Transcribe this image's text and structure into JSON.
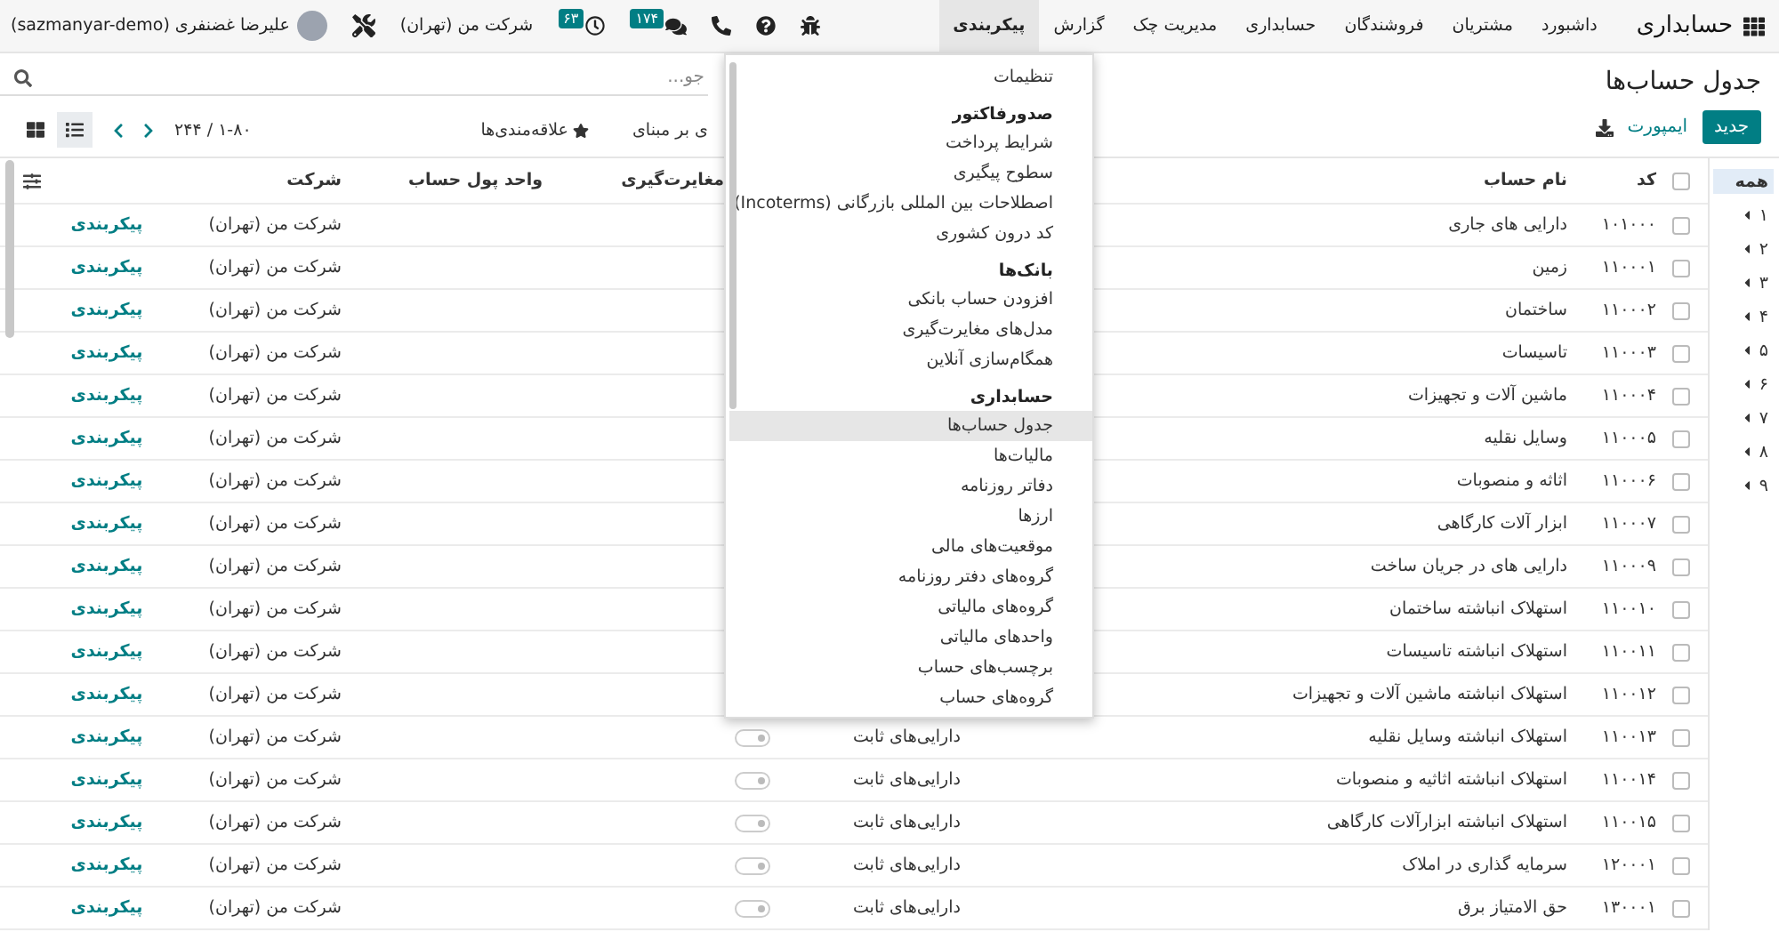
{
  "navbar": {
    "app_name": "حسابداری",
    "menu": [
      {
        "label": "داشبورد",
        "selected": false
      },
      {
        "label": "مشتریان",
        "selected": false
      },
      {
        "label": "فروشندگان",
        "selected": false
      },
      {
        "label": "حسابداری",
        "selected": false
      },
      {
        "label": "مدیریت چک",
        "selected": false
      },
      {
        "label": "گزارش",
        "selected": false
      },
      {
        "label": "پیکربندی",
        "selected": true
      }
    ],
    "systray": {
      "chat_badge": "۱۷۴",
      "activity_badge": "۶۳",
      "company": "شرکت من (تهران)",
      "user": "علیرضا غضنفری (sazmanyar-demo)"
    }
  },
  "control_panel": {
    "title": "جدول حساب‌ها",
    "new_button": "جدید",
    "import_button": "ایمپورت",
    "search": {
      "placeholder": "جو..."
    },
    "group_by": "ی بر مبنای",
    "favorites": "علاقه‌مندی‌ها",
    "pager": "۱-۸۰ / ۲۴۴",
    "views": [
      {
        "kind": "list",
        "selected": true
      },
      {
        "kind": "kanban",
        "selected": false
      }
    ]
  },
  "sidebar": {
    "items": [
      {
        "label": "همه",
        "selected": true
      },
      {
        "label": "۱",
        "selected": false
      },
      {
        "label": "۲",
        "selected": false
      },
      {
        "label": "۳",
        "selected": false
      },
      {
        "label": "۴",
        "selected": false
      },
      {
        "label": "۵",
        "selected": false
      },
      {
        "label": "۶",
        "selected": false
      },
      {
        "label": "۷",
        "selected": false
      },
      {
        "label": "۸",
        "selected": false
      },
      {
        "label": "۹",
        "selected": false
      }
    ]
  },
  "table": {
    "select_all_checked": false,
    "headers": {
      "code": "کد",
      "name": "نام حساب",
      "reconcile": "مغایرت‌گیری",
      "currency": "واحد پول حساب",
      "company": "شرکت"
    },
    "rows": [
      {
        "checked": false,
        "code": "۱۰۱۰۰۰",
        "name": "دارایی های جاری",
        "company": "شرکت من (تهران)",
        "action": "پیکربندی"
      },
      {
        "checked": false,
        "code": "۱۱۰۰۰۱",
        "name": "زمین",
        "company": "شرکت من (تهران)",
        "action": "پیکربندی"
      },
      {
        "checked": false,
        "code": "۱۱۰۰۰۲",
        "name": "ساختمان",
        "company": "شرکت من (تهران)",
        "action": "پیکربندی"
      },
      {
        "checked": false,
        "code": "۱۱۰۰۰۳",
        "name": "تاسیسات",
        "company": "شرکت من (تهران)",
        "action": "پیکربندی"
      },
      {
        "checked": false,
        "code": "۱۱۰۰۰۴",
        "name": "ماشین آلات و تجهیزات",
        "company": "شرکت من (تهران)",
        "action": "پیکربندی"
      },
      {
        "checked": false,
        "code": "۱۱۰۰۰۵",
        "name": "وسایل نقلیه",
        "company": "شرکت من (تهران)",
        "action": "پیکربندی"
      },
      {
        "checked": false,
        "code": "۱۱۰۰۰۶",
        "name": "اثاثه و منصوبات",
        "company": "شرکت من (تهران)",
        "action": "پیکربندی"
      },
      {
        "checked": false,
        "code": "۱۱۰۰۰۷",
        "name": "ابزار آلات کارگاهی",
        "company": "شرکت من (تهران)",
        "action": "پیکربندی"
      },
      {
        "checked": false,
        "code": "۱۱۰۰۰۹",
        "name": "دارایی های در جریان ساخت",
        "company": "شرکت من (تهران)",
        "action": "پیکربندی"
      },
      {
        "checked": false,
        "code": "۱۱۰۰۱۰",
        "name": "استهلاک انباشته ساختمان",
        "company": "شرکت من (تهران)",
        "action": "پیکربندی"
      },
      {
        "checked": false,
        "code": "۱۱۰۰۱۱",
        "name": "استهلاک انباشته تاسیسات",
        "company": "شرکت من (تهران)",
        "action": "پیکربندی"
      },
      {
        "checked": false,
        "code": "۱۱۰۰۱۲",
        "name": "استهلاک انباشته ماشین آلات و تجهیزات",
        "company": "شرکت من (تهران)",
        "action": "پیکربندی"
      },
      {
        "checked": false,
        "code": "۱۱۰۰۱۳",
        "name": "استهلاک انباشته وسایل نقلیه",
        "type": "دارایی‌های ثابت",
        "reconcile": false,
        "company": "شرکت من (تهران)",
        "action": "پیکربندی"
      },
      {
        "checked": false,
        "code": "۱۱۰۰۱۴",
        "name": "استهلاک انباشته اثاثیه و منصوبات",
        "type": "دارایی‌های ثابت",
        "reconcile": false,
        "company": "شرکت من (تهران)",
        "action": "پیکربندی"
      },
      {
        "checked": false,
        "code": "۱۱۰۰۱۵",
        "name": "استهلاک انباشته ابزارآلات کارگاهی",
        "type": "دارایی‌های ثابت",
        "reconcile": false,
        "company": "شرکت من (تهران)",
        "action": "پیکربندی"
      },
      {
        "checked": false,
        "code": "۱۲۰۰۰۱",
        "name": "سرمایه گذاری در املاک",
        "type": "دارایی‌های ثابت",
        "reconcile": false,
        "company": "شرکت من (تهران)",
        "action": "پیکربندی"
      },
      {
        "checked": false,
        "code": "۱۳۰۰۰۱",
        "name": "حق الامتیاز برق",
        "type": "دارایی‌های ثابت",
        "reconcile": false,
        "company": "شرکت من (تهران)",
        "action": "پیکربندی"
      }
    ]
  },
  "dropdown": {
    "items": [
      {
        "kind": "item",
        "label": "تنظیمات",
        "selected": false
      },
      {
        "kind": "header",
        "label": "صدورفاکتور"
      },
      {
        "kind": "item",
        "label": "شرایط پرداخت",
        "selected": false
      },
      {
        "kind": "item",
        "label": "سطوح پیگیری",
        "selected": false
      },
      {
        "kind": "item",
        "label": "اصطلاحات بین المللی بازرگانی (Incoterms)",
        "selected": false
      },
      {
        "kind": "item",
        "label": "کد درون کشوری",
        "selected": false
      },
      {
        "kind": "header",
        "label": "بانک‌ها"
      },
      {
        "kind": "item",
        "label": "افزودن حساب بانکی",
        "selected": false
      },
      {
        "kind": "item",
        "label": "مدل‌های مغایرت‌گیری",
        "selected": false
      },
      {
        "kind": "item",
        "label": "همگام‌سازی آنلاین",
        "selected": false
      },
      {
        "kind": "header",
        "label": "حسابداری"
      },
      {
        "kind": "item",
        "label": "جدول حساب‌ها",
        "selected": true
      },
      {
        "kind": "item",
        "label": "مالیات‌ها",
        "selected": false
      },
      {
        "kind": "item",
        "label": "دفاتر روزنامه",
        "selected": false
      },
      {
        "kind": "item",
        "label": "ارزها",
        "selected": false
      },
      {
        "kind": "item",
        "label": "موقعیت‌های مالی",
        "selected": false
      },
      {
        "kind": "item",
        "label": "گروه‌های دفتر روزنامه",
        "selected": false
      },
      {
        "kind": "item",
        "label": "گروه‌های مالیاتی",
        "selected": false
      },
      {
        "kind": "item",
        "label": "واحدهای مالیاتی",
        "selected": false
      },
      {
        "kind": "item",
        "label": "برچسب‌های حساب",
        "selected": false
      },
      {
        "kind": "item",
        "label": "گروه‌های حساب",
        "selected": false
      }
    ]
  }
}
